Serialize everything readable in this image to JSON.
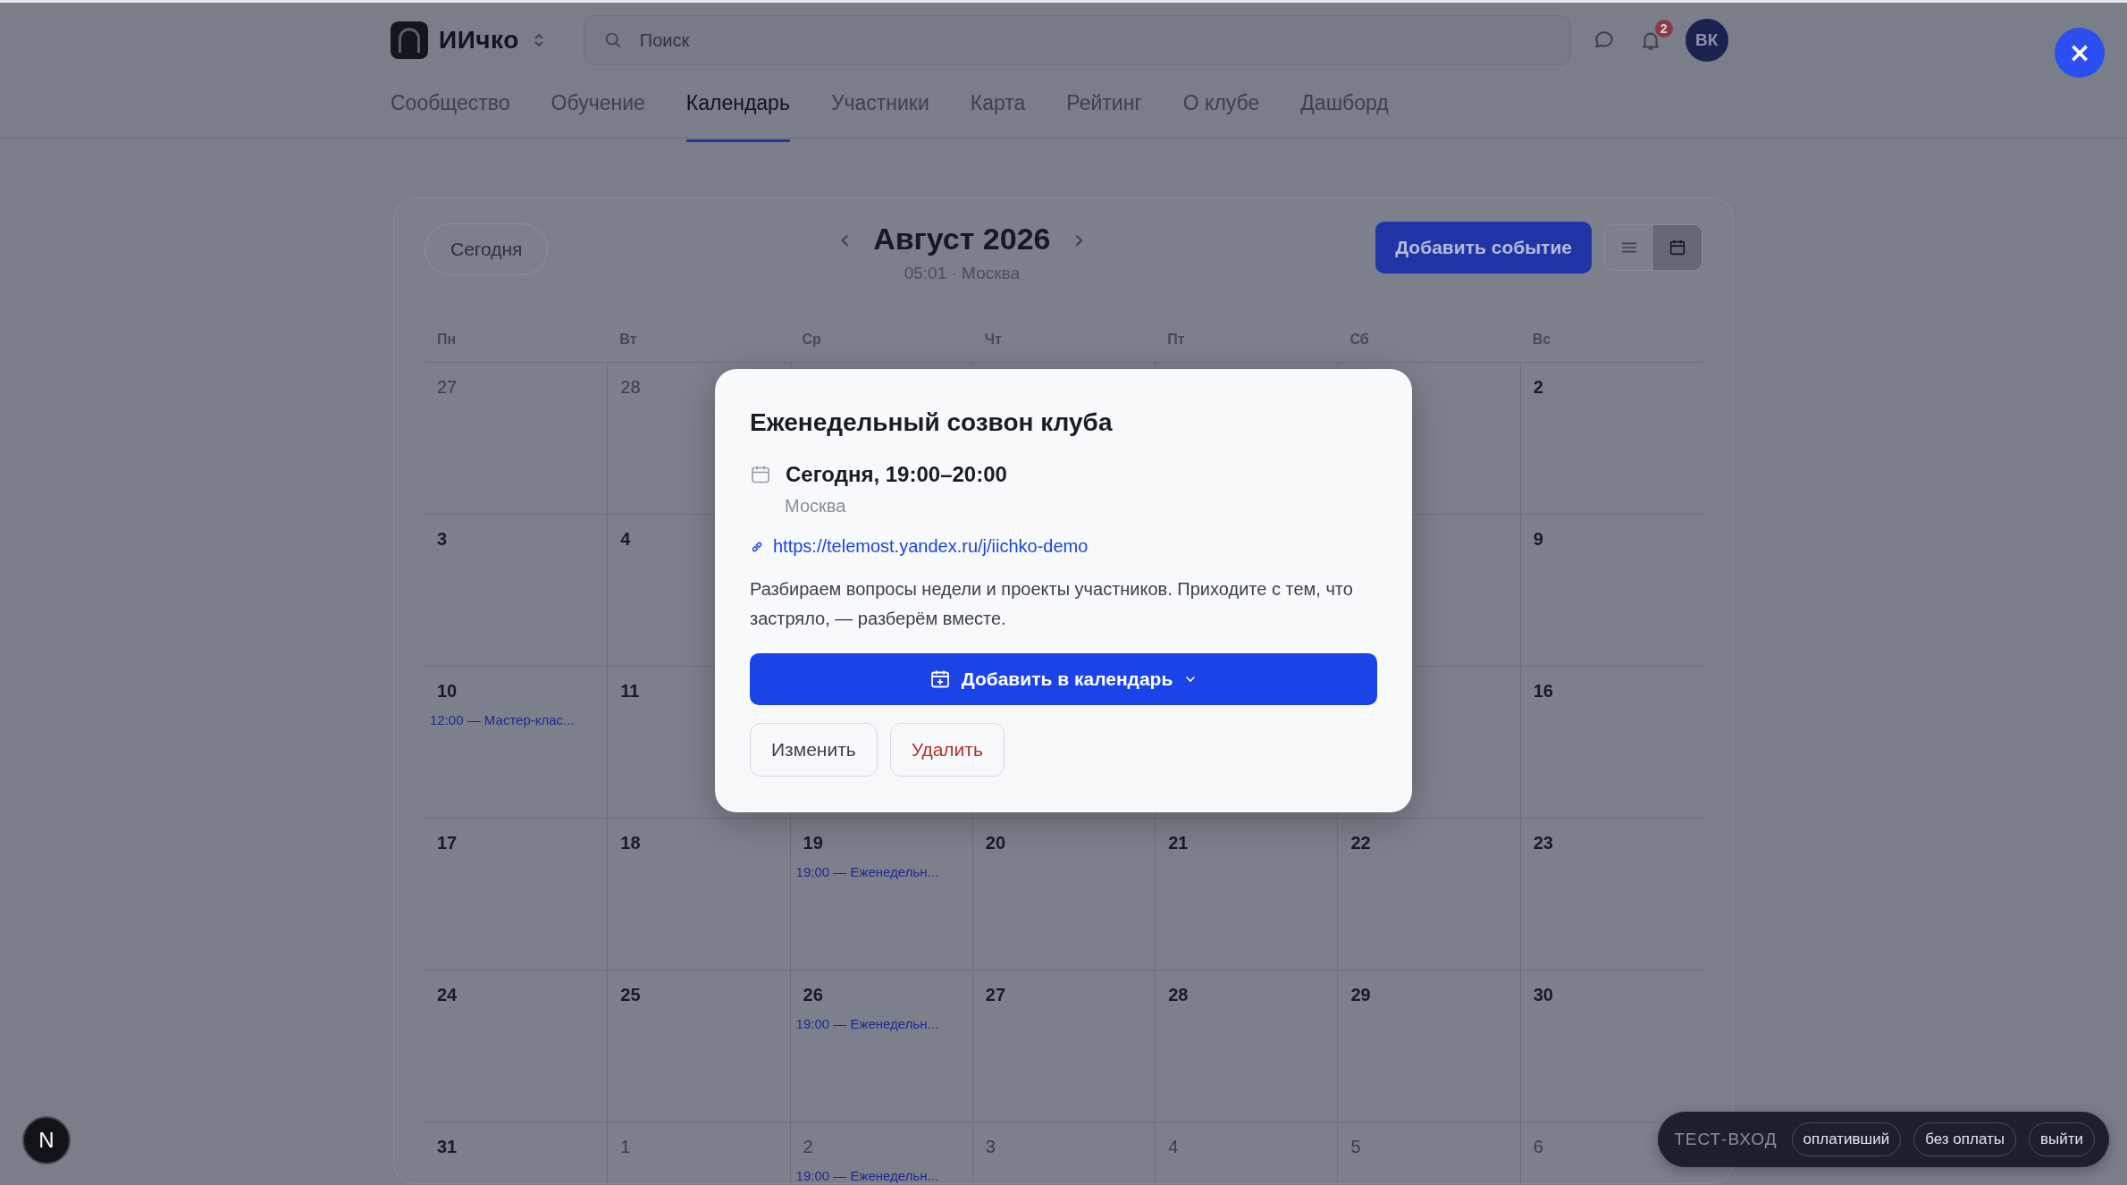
{
  "app": {
    "name": "ИИчко"
  },
  "search": {
    "placeholder": "Поиск"
  },
  "notifications": {
    "count": "2"
  },
  "avatar": {
    "initials": "ВК"
  },
  "nav_tabs": [
    {
      "label": "Сообщество",
      "selected": false
    },
    {
      "label": "Обучение",
      "selected": false
    },
    {
      "label": "Календарь",
      "selected": true
    },
    {
      "label": "Участники",
      "selected": false
    },
    {
      "label": "Карта",
      "selected": false
    },
    {
      "label": "Рейтинг",
      "selected": false
    },
    {
      "label": "О клубе",
      "selected": false
    },
    {
      "label": "Дашборд",
      "selected": false
    }
  ],
  "calendar": {
    "today_button": "Сегодня",
    "prev": "‹",
    "month": "Август 2026",
    "next": "›",
    "clock": "05:01 · Москва",
    "add_button": "Добавить событие",
    "views": [
      {
        "kind": "list",
        "selected": false
      },
      {
        "kind": "month",
        "selected": true
      }
    ],
    "weekdays": [
      "Пн",
      "Вт",
      "Ср",
      "Чт",
      "Пт",
      "Сб",
      "Вс"
    ],
    "weeks": [
      {
        "cells_before_dialog": [
          {
            "day": "27",
            "outside_month": true
          },
          {
            "day": "28",
            "outside_month": true
          }
        ],
        "cells_after_dialog": [
          {
            "day": "2",
            "outside_month": false
          }
        ]
      },
      {
        "cells_before_dialog": [
          {
            "day": "3",
            "outside_month": false
          },
          {
            "day": "4",
            "outside_month": false
          }
        ],
        "cells_after_dialog": [
          {
            "day": "9",
            "outside_month": false
          }
        ]
      },
      {
        "cells_before_dialog": [
          {
            "day": "10",
            "outside_month": false,
            "events": [
              "12:00 — Мастер-клас..."
            ]
          },
          {
            "day": "11",
            "outside_month": false
          }
        ],
        "cells_after_dialog": [
          {
            "day": "16",
            "outside_month": false
          }
        ]
      },
      {
        "cells": [
          {
            "day": "17",
            "outside_month": false
          },
          {
            "day": "18",
            "outside_month": false
          },
          {
            "day": "19",
            "outside_month": false,
            "events": [
              "19:00 — Еженедельн..."
            ]
          },
          {
            "day": "20",
            "outside_month": false
          },
          {
            "day": "21",
            "outside_month": false
          },
          {
            "day": "22",
            "outside_month": false
          },
          {
            "day": "23",
            "outside_month": false
          }
        ]
      },
      {
        "cells": [
          {
            "day": "24",
            "outside_month": false
          },
          {
            "day": "25",
            "outside_month": false
          },
          {
            "day": "26",
            "outside_month": false,
            "events": [
              "19:00 — Еженедельн..."
            ]
          },
          {
            "day": "27",
            "outside_month": false
          },
          {
            "day": "28",
            "outside_month": false
          },
          {
            "day": "29",
            "outside_month": false
          },
          {
            "day": "30",
            "outside_month": false
          }
        ]
      },
      {
        "cells": [
          {
            "day": "31",
            "outside_month": false
          },
          {
            "day": "1",
            "outside_month": true
          },
          {
            "day": "2",
            "outside_month": true,
            "events": [
              "19:00 — Еженедельн..."
            ]
          },
          {
            "day": "3",
            "outside_month": true
          },
          {
            "day": "4",
            "outside_month": true
          },
          {
            "day": "5",
            "outside_month": true
          },
          {
            "day": "6",
            "outside_month": true
          }
        ]
      }
    ]
  },
  "event_dialog": {
    "title": "Еженедельный созвон клуба",
    "when": "Сегодня, 19:00–20:00",
    "place": "Москва",
    "link": "https://telemost.yandex.ru/j/iichko-demo",
    "description": "Разбираем вопросы недели и проекты участников. Приходите с тем, что застряло, — разберём вместе.",
    "add_to_calendar": "Добавить в календарь",
    "edit": "Изменить",
    "delete": "Удалить"
  },
  "test_login": {
    "label": "ТЕСТ-ВХОД",
    "options": [
      "оплативший",
      "без оплаты",
      "выйти"
    ]
  },
  "close_button": "×",
  "dev_badge": "N"
}
